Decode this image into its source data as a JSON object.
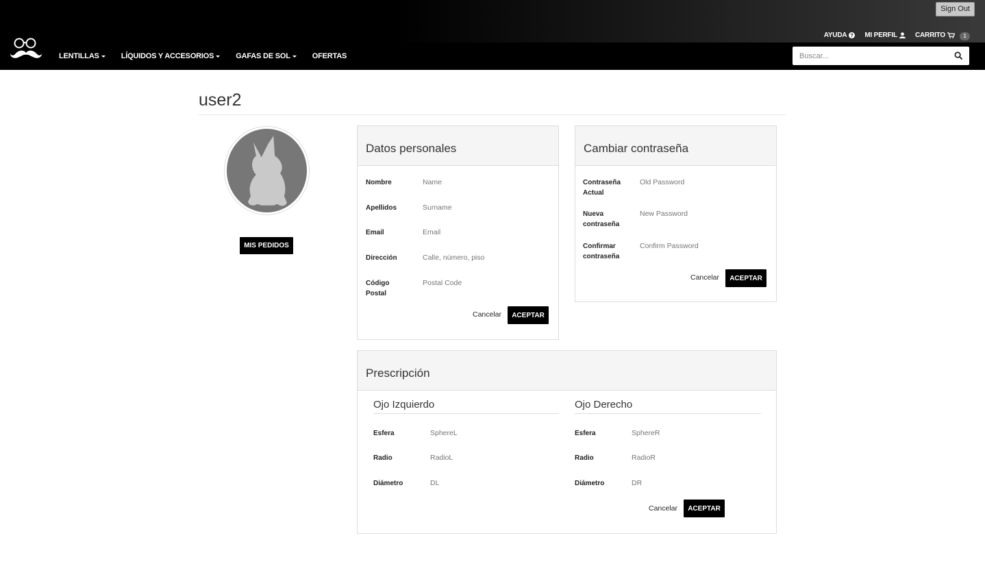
{
  "topbar": {
    "sign_out": "Sign Out",
    "help": "AYUDA",
    "profile": "MI PERFIL",
    "cart": "CARRITO",
    "cart_count": "1"
  },
  "nav": {
    "items": [
      "LENTILLAS",
      "LÍQUIDOS Y ACCESORIOS",
      "GAFAS DE SOL",
      "OFERTAS"
    ],
    "search_placeholder": "Buscar..."
  },
  "page": {
    "title": "user2",
    "orders_button": "MIS PEDIDOS"
  },
  "personal": {
    "title": "Datos personales",
    "fields": [
      {
        "label": "Nombre",
        "placeholder": "Name"
      },
      {
        "label": "Apellidos",
        "placeholder": "Surname"
      },
      {
        "label": "Email",
        "placeholder": "Email"
      },
      {
        "label": "Dirección",
        "placeholder": "Calle, número, piso"
      },
      {
        "label": "Código Postal",
        "placeholder": "Postal Code"
      }
    ],
    "cancel": "Cancelar",
    "accept": "ACEPTAR"
  },
  "password": {
    "title": "Cambiar contraseña",
    "fields": [
      {
        "label": "Contraseña Actual",
        "placeholder": "Old Password"
      },
      {
        "label": "Nueva contraseña",
        "placeholder": "New Password"
      },
      {
        "label": "Confirmar contraseña",
        "placeholder": "Confirm Password"
      }
    ],
    "cancel": "Cancelar",
    "accept": "ACEPTAR"
  },
  "prescription": {
    "title": "Prescripción",
    "left": {
      "title": "Ojo Izquierdo",
      "fields": [
        {
          "label": "Esfera",
          "placeholder": "SphereL"
        },
        {
          "label": "Radio",
          "placeholder": "RadioL"
        },
        {
          "label": "Diámetro",
          "placeholder": "DL"
        }
      ]
    },
    "right": {
      "title": "Ojo Derecho",
      "fields": [
        {
          "label": "Esfera",
          "placeholder": "SphereR"
        },
        {
          "label": "Radio",
          "placeholder": "RadioR"
        },
        {
          "label": "Diámetro",
          "placeholder": "DR"
        }
      ]
    },
    "cancel": "Cancelar",
    "accept": "ACEPTAR"
  }
}
